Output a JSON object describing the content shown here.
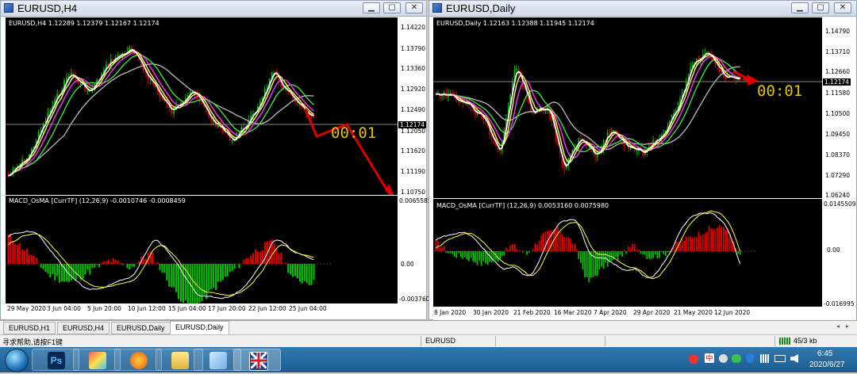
{
  "left_window": {
    "title": "EURUSD,H4",
    "header": "EURUSD,H4  1.12289 1.12379 1.12167 1.12174",
    "price_ticks": [
      "1.14220",
      "1.13790",
      "1.13360",
      "1.12920",
      "1.12490",
      "1.12050",
      "1.11620",
      "1.11190",
      "1.10750"
    ],
    "current_price": "1.12174",
    "timer": "00:01",
    "osc_header": "MACD_OsMA [CurrTF] (12,26,9) -0.0010746 -0.0008459",
    "osc_ticks": [
      "0.0065585",
      "0.00",
      "-0.003760"
    ],
    "dates": [
      "29 May 2020",
      "3 Jun 04:00",
      "5 Jun 20:00",
      "10 Jun 12:00",
      "15 Jun 04:00",
      "17 Jun 20:00",
      "22 Jun 12:00",
      "25 Jun 04:00"
    ]
  },
  "right_window": {
    "title": "EURUSD,Daily",
    "header": "EURUSD,Daily  1.12163 1.12388 1.11945 1.12174",
    "price_ticks": [
      "1.14790",
      "1.13710",
      "1.12660",
      "1.11580",
      "1.10500",
      "1.09450",
      "1.08370",
      "1.07290",
      "1.06240"
    ],
    "current_price": "1.12174",
    "timer": "00:01",
    "osc_header": "MACD_OsMA [CurrTF] (12,26,9) 0.0053160 0.0075980",
    "osc_ticks": [
      "0.0145509",
      "0.00",
      "-0.016995"
    ],
    "dates": [
      "8 Jan 2020",
      "30 Jan 2020",
      "21 Feb 2020",
      "16 Mar 2020",
      "7 Apr 2020",
      "29 Apr 2020",
      "21 May 2020",
      "12 Jun 2020"
    ]
  },
  "tabs": [
    "EURUSD,H1",
    "EURUSD,H4",
    "EURUSD,Daily",
    "EURUSD,Daily"
  ],
  "status": {
    "help": "寻求帮助,请按F1键",
    "symbol": "EURUSD",
    "traffic": "45/3 kb"
  },
  "taskbar": {
    "clock_time": "6:45",
    "clock_date": "2020/6/27",
    "apps": [
      "start-orb",
      "photoshop",
      "paint",
      "firefox",
      "explorer",
      "notepad",
      "metatrader"
    ]
  },
  "colors": {
    "bull": "#00c000",
    "bear": "#e00000",
    "ma_fast": "#ffffff",
    "ma_yellow": "#ffff40",
    "ma_magenta": "#ff30ff",
    "ma_green": "#40e040",
    "ma_gray": "#b0b0b0",
    "arrow": "#e00000"
  }
}
